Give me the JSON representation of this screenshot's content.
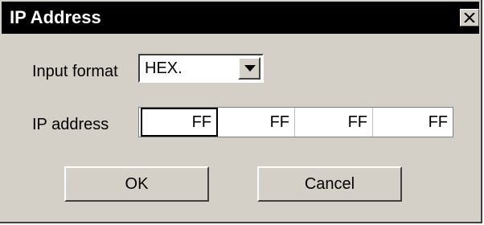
{
  "dialog": {
    "title": "IP Address",
    "close_icon": "close-icon"
  },
  "input_format": {
    "label": "Input format",
    "value": "HEX.",
    "dropdown_icon": "chevron-down-icon"
  },
  "ip_address": {
    "label": "IP address",
    "octets": [
      "FF",
      "FF",
      "FF",
      "FF"
    ]
  },
  "buttons": {
    "ok_label": "OK",
    "cancel_label": "Cancel"
  },
  "colors": {
    "face": "#d4d0c8",
    "titlebar": "#000000",
    "title_text": "#ffffff"
  }
}
